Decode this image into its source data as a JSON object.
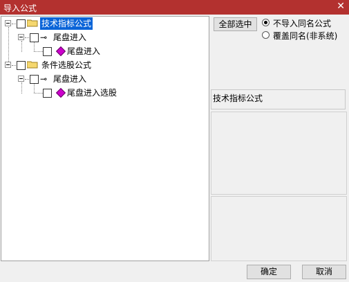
{
  "window": {
    "title": "导入公式"
  },
  "tree": {
    "nodes": [
      {
        "label": "技术指标公式"
      },
      {
        "label": "尾盘进入"
      },
      {
        "label": "尾盘进入"
      },
      {
        "label": "条件选股公式"
      },
      {
        "label": "尾盘进入"
      },
      {
        "label": "尾盘进入选股"
      }
    ]
  },
  "options": {
    "select_all_label": "全部选中",
    "radio_options": [
      {
        "label": "不导入同名公式",
        "selected": true
      },
      {
        "label": "覆盖同名(非系统)",
        "selected": false
      }
    ]
  },
  "info": {
    "formula_type": "技术指标公式"
  },
  "footer": {
    "ok_label": "确定",
    "cancel_label": "取消"
  },
  "colors": {
    "titlebar": "#b3312f",
    "selection": "#0a64d8",
    "formula_icon": "#cc00cc"
  },
  "icons": [
    "close-icon",
    "folder-icon",
    "formula-group-icon",
    "formula-icon"
  ]
}
